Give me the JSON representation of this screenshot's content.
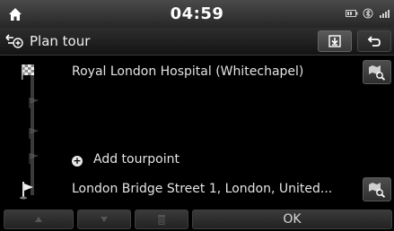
{
  "status": {
    "time": "04:59"
  },
  "header": {
    "title": "Plan tour"
  },
  "tour": {
    "start": "Royal London Hospital (Whitechapel)",
    "add_label": "Add tourpoint",
    "destination": "London Bridge Street 1, London, United..."
  },
  "footer": {
    "ok_label": "OK"
  },
  "icons": {
    "home": "home-icon",
    "route_plus": "route-plus-icon",
    "download": "download-icon",
    "back": "back-arrow-icon",
    "checkered_flag": "checkered-flag-icon",
    "map_search": "map-search-icon",
    "add": "plus-circle-icon",
    "destination_flag": "destination-flag-icon",
    "up": "up-arrow-icon",
    "down": "down-arrow-icon",
    "trash": "trash-icon"
  },
  "colors": {
    "background": "#000000",
    "bar": "#2e2e2e",
    "text": "#e4e4e4",
    "disabled": "#555555"
  }
}
